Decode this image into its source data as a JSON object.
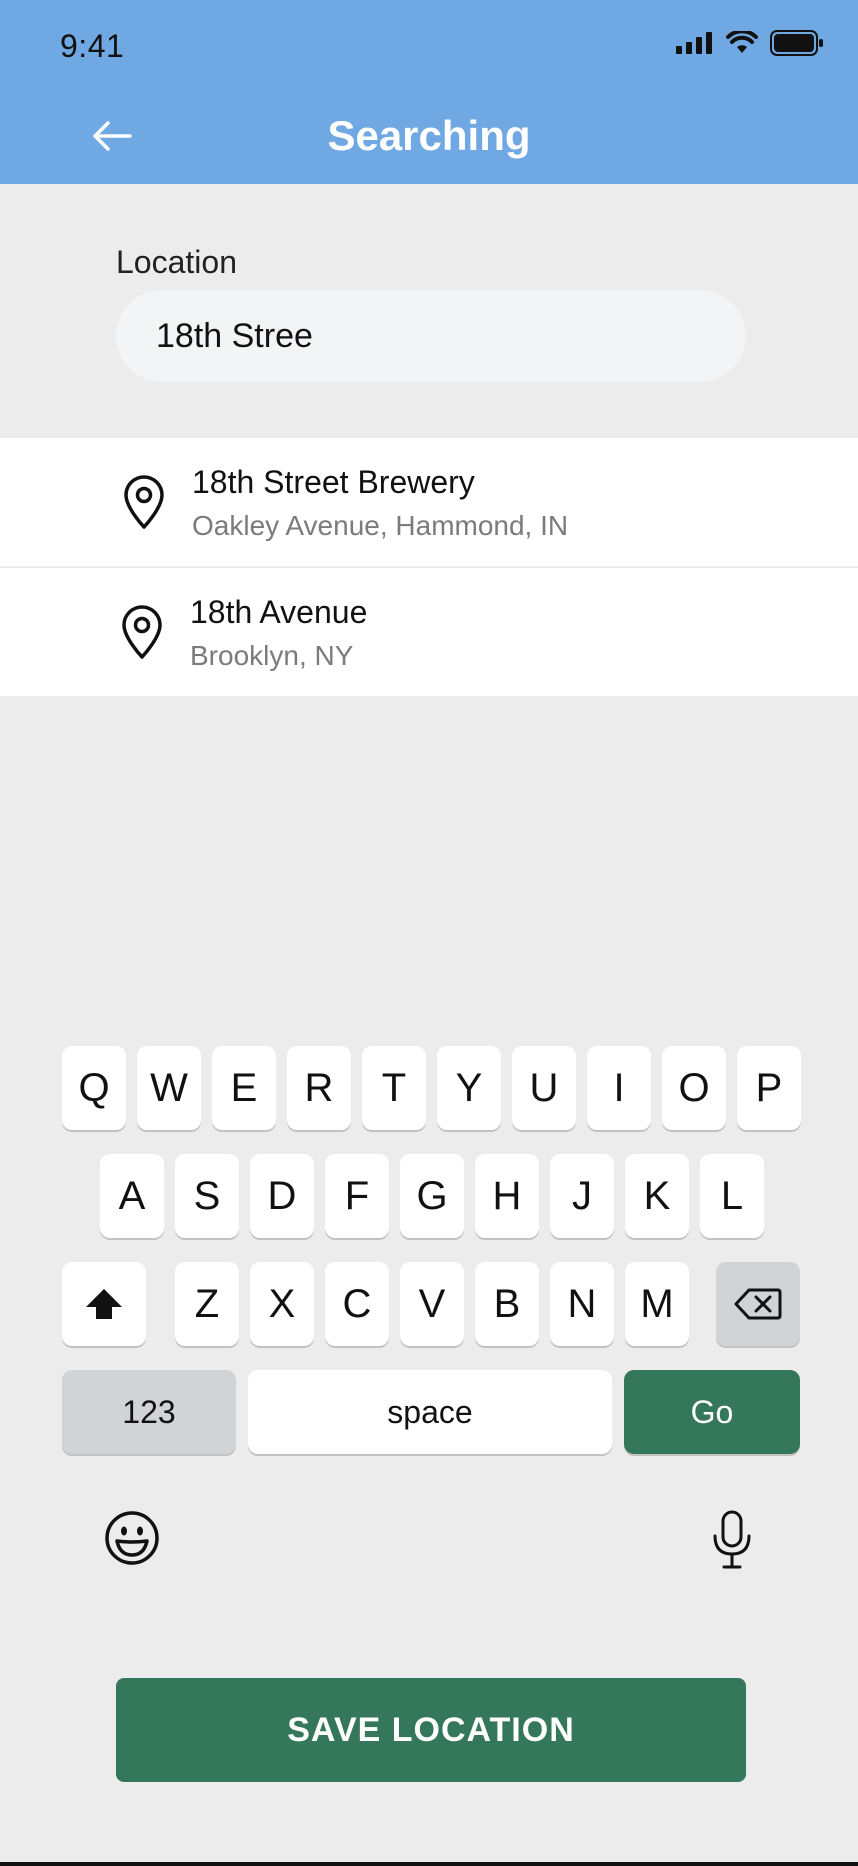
{
  "status_bar": {
    "time": "9:41"
  },
  "header": {
    "title": "Searching"
  },
  "location": {
    "label": "Location",
    "value": "18th Stree"
  },
  "results": [
    {
      "name": "18th Street Brewery",
      "address": "Oakley Avenue, Hammond, IN"
    },
    {
      "name": "18th Avenue",
      "address": "Brooklyn, NY"
    }
  ],
  "keyboard": {
    "row1": [
      "Q",
      "W",
      "E",
      "R",
      "T",
      "Y",
      "U",
      "I",
      "O",
      "P"
    ],
    "row2": [
      "A",
      "S",
      "D",
      "F",
      "G",
      "H",
      "J",
      "K",
      "L"
    ],
    "row3": [
      "Z",
      "X",
      "C",
      "V",
      "B",
      "N",
      "M"
    ],
    "numbers_label": "123",
    "space_label": "space",
    "go_label": "Go"
  },
  "save_button": {
    "label": "SAVE LOCATION"
  },
  "colors": {
    "header": "#6fa8e2",
    "accent": "#35775a",
    "background": "#ececec"
  },
  "icons": [
    "back-arrow-icon",
    "signal-icon",
    "wifi-icon",
    "battery-icon",
    "location-pin-icon",
    "shift-icon",
    "backspace-icon",
    "emoji-icon",
    "microphone-icon"
  ]
}
